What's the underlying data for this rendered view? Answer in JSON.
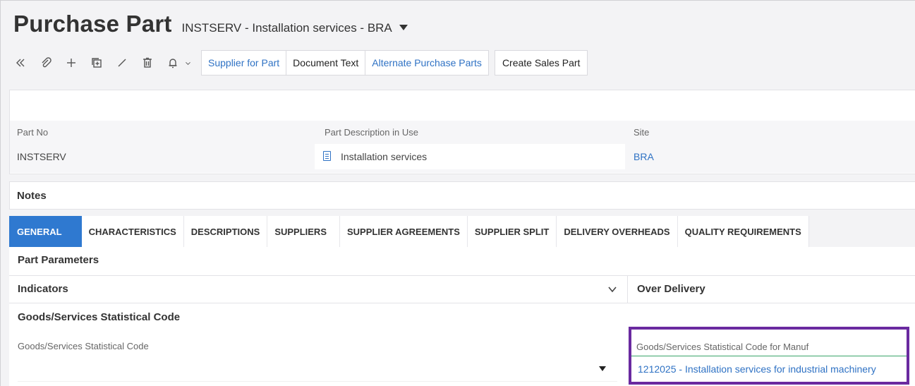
{
  "header": {
    "title": "Purchase Part",
    "subtitle": "INSTSERV - Installation services - BRA"
  },
  "toolbar": {
    "icons": [
      "collapse-icon",
      "attachment-icon",
      "add-icon",
      "duplicate-icon",
      "edit-icon",
      "delete-icon",
      "bell-icon",
      "chevron-down-icon"
    ],
    "buttons": {
      "supplier_for_part": "Supplier for Part",
      "document_text": "Document Text",
      "alternate_purchase_parts": "Alternate Purchase Parts",
      "create_sales_part": "Create Sales Part"
    }
  },
  "fields": {
    "part_no": {
      "label": "Part No",
      "value": "INSTSERV"
    },
    "part_description": {
      "label": "Part Description in Use",
      "value": "Installation services"
    },
    "site": {
      "label": "Site",
      "value": "BRA"
    }
  },
  "notes": {
    "label": "Notes"
  },
  "tabs": [
    {
      "label": "GENERAL",
      "active": true
    },
    {
      "label": "CHARACTERISTICS"
    },
    {
      "label": "DESCRIPTIONS"
    },
    {
      "label": "SUPPLIERS"
    },
    {
      "label": "SUPPLIER AGREEMENTS"
    },
    {
      "label": "SUPPLIER SPLIT"
    },
    {
      "label": "DELIVERY OVERHEADS"
    },
    {
      "label": "QUALITY REQUIREMENTS"
    }
  ],
  "sections": {
    "part_parameters": "Part Parameters",
    "indicators": "Indicators",
    "over_delivery": "Over Delivery",
    "goods_services": "Goods/Services Statistical Code"
  },
  "goods_code": {
    "label": "Goods/Services Statistical Code",
    "value": ""
  },
  "goods_code_manuf": {
    "label": "Goods/Services Statistical Code for Manuf",
    "value": "1212025 - Installation services for industrial machinery"
  },
  "colors": {
    "accent": "#2f79d0",
    "link": "#2f72c4",
    "highlight": "#6a2aa0"
  }
}
